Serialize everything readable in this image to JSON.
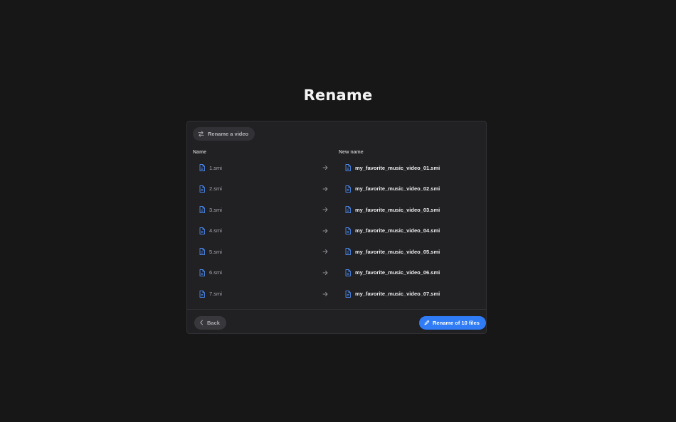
{
  "page": {
    "title": "Rename"
  },
  "mode": {
    "label": "Rename a video",
    "icon": "swap-arrows-icon"
  },
  "columns": {
    "name": "Name",
    "new_name": "New name"
  },
  "files": [
    {
      "old": "1.smi",
      "new": "my_favorite_music_video_01.smi"
    },
    {
      "old": "2.smi",
      "new": "my_favorite_music_video_02.smi"
    },
    {
      "old": "3.smi",
      "new": "my_favorite_music_video_03.smi"
    },
    {
      "old": "4.smi",
      "new": "my_favorite_music_video_04.smi"
    },
    {
      "old": "5.smi",
      "new": "my_favorite_music_video_05.smi"
    },
    {
      "old": "6.smi",
      "new": "my_favorite_music_video_06.smi"
    },
    {
      "old": "7.smi",
      "new": "my_favorite_music_video_07.smi"
    }
  ],
  "footer": {
    "back_label": "Back",
    "rename_label": "Rename of 10 files"
  },
  "colors": {
    "background": "#171718",
    "panel": "#212124",
    "accent": "#2f7cf6",
    "file_icon": "#4a86e8"
  }
}
